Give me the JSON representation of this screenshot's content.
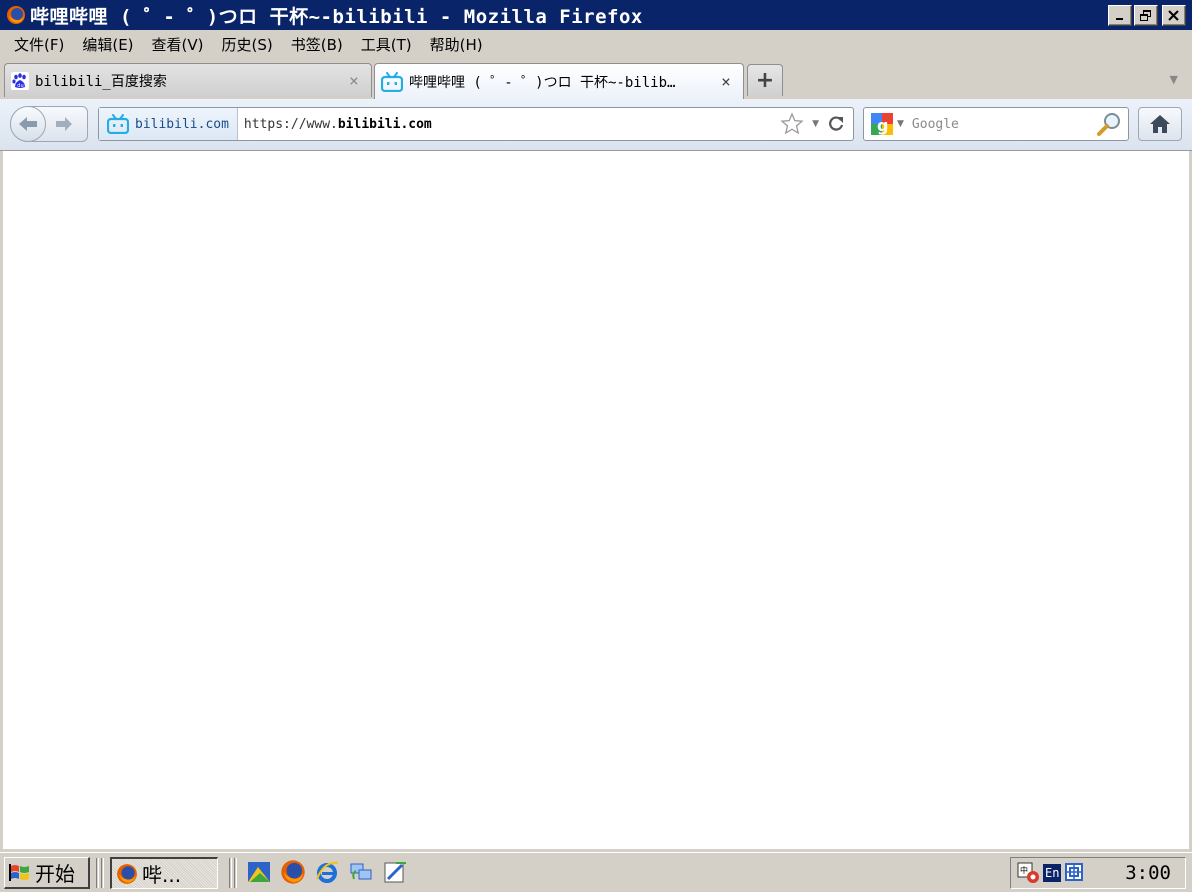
{
  "window": {
    "title": "哔哩哔哩 ( ゜- ゜)つロ 干杯~-bilibili - Mozilla Firefox"
  },
  "menu": {
    "items": [
      "文件(F)",
      "编辑(E)",
      "查看(V)",
      "历史(S)",
      "书签(B)",
      "工具(T)",
      "帮助(H)"
    ]
  },
  "tabs": [
    {
      "label": "bilibili_百度搜索",
      "close": "×",
      "icon": "baidu-paw-icon",
      "active": false
    },
    {
      "label": "哔哩哔哩 ( ゜- ゜)つロ 干杯~-bilib…",
      "close": "×",
      "icon": "bilibili-tv-icon",
      "active": true
    }
  ],
  "newtab": {
    "label": "+"
  },
  "navbar": {
    "identity_label": "bilibili.com",
    "url_prefix": "https://www.",
    "url_host": "bilibili.com",
    "search_placeholder": "Google",
    "search_engine_icon": "google-icon"
  },
  "taskbar": {
    "start_label": "开始",
    "task_label": "哔...",
    "clock": "3:00",
    "tray_lang": "En"
  },
  "colors": {
    "titlebar": "#0a246a",
    "chrome": "#d4d0c8",
    "bilibili_blue": "#23ade5"
  }
}
